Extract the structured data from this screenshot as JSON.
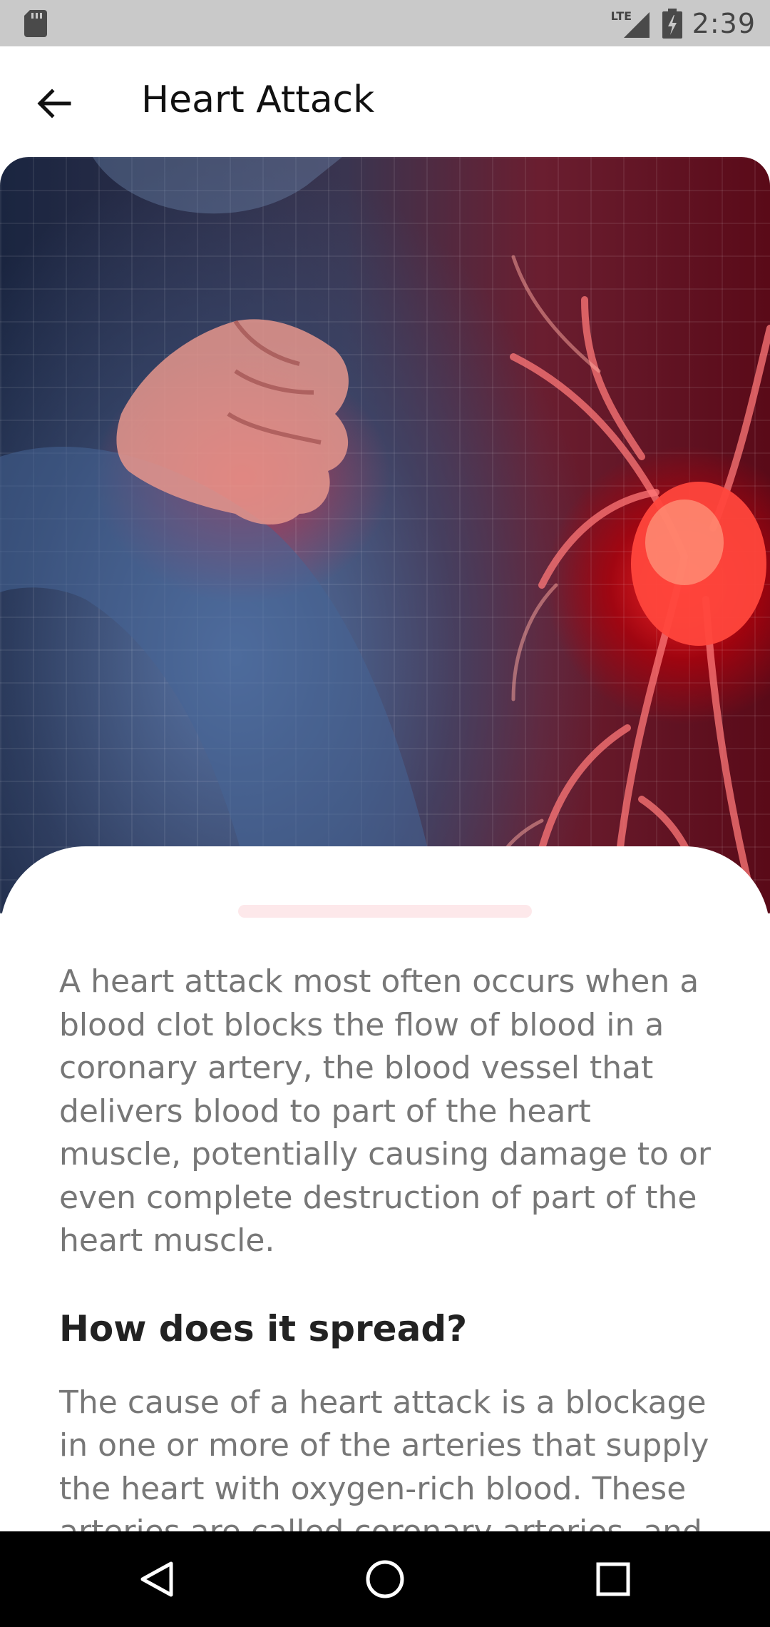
{
  "status_bar": {
    "time": "2:39",
    "network": "LTE",
    "icons": [
      "sd-card-icon",
      "lte-signal-icon",
      "battery-charging-icon"
    ]
  },
  "app_bar": {
    "title": "Heart Attack",
    "back_icon": "back-arrow-icon"
  },
  "hero_image": {
    "description_icon": "heart-attack-illustration",
    "accent": "#e0202b"
  },
  "article": {
    "intro": "A heart attack most often occurs when a blood clot blocks the flow of blood in a coronary artery, the blood vessel that delivers blood to part of the heart muscle, potentially causing damage to or even complete destruction of part of the heart muscle.",
    "section_heading": "How does it spread?",
    "section_text": "The cause of a heart attack is a blockage in one or more of the arteries that supply the heart with oxygen-rich blood. These arteries are called coronary arteries, and"
  },
  "nav_bar": {
    "buttons": [
      "back-nav-icon",
      "home-nav-icon",
      "recents-nav-icon"
    ]
  }
}
